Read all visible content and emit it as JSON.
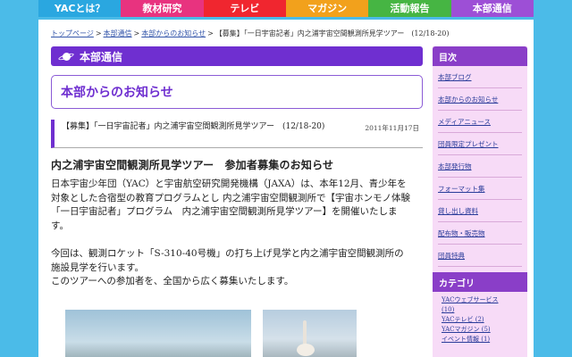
{
  "nav": {
    "items": [
      {
        "label": "YACとは？",
        "color": "#2aa7e0"
      },
      {
        "label": "教材研究",
        "color": "#e8337f"
      },
      {
        "label": "テレビ",
        "color": "#f0262f"
      },
      {
        "label": "マガジン",
        "color": "#f2a11c"
      },
      {
        "label": "活動報告",
        "color": "#46b543"
      },
      {
        "label": "本部通信",
        "color": "#9d4fd6"
      }
    ]
  },
  "breadcrumb": {
    "top": "トップページ",
    "honbu": "本部通信",
    "oshirase": "本部からのお知らせ",
    "current": "【募集】「一日宇宙記者」内之浦宇宙空間観測所見学ツアー　(12/18-20)",
    "separator": ">"
  },
  "section": {
    "bar_title": "本部通信",
    "notice_title": "本部からのお知らせ"
  },
  "article": {
    "title": "【募集】「一日宇宙記者」内之浦宇宙空間観測所見学ツアー　(12/18-20)",
    "date": "2011年11月17日",
    "headline": "内之浦宇宙空間観測所見学ツアー　参加者募集のお知らせ",
    "paragraph1": "日本宇宙少年団（YAC）と宇宙航空研究開発機構（JAXA）は、本年12月、青少年を対象とした合宿型の教育プログラムとし 内之浦宇宙空間観測所で【宇宙ホンモノ体験「一日宇宙記者」プログラム　内之浦宇宙空間観測所見学ツアー】を開催いたします。",
    "paragraph2": "今回は、観測ロケット「S-310-40号機」の打ち上げ見学と内之浦宇宙空間観測所の施設見学を行います。",
    "paragraph3": "このツアーへの参加者を、全国から広く募集いたします。"
  },
  "sidebar": {
    "menu_title": "目次",
    "items": [
      "本部ブログ",
      "本部からのお知らせ",
      "メディアニュース",
      "団員限定プレゼント",
      "本部発行物",
      "フォーマット集",
      "貸し出し資料",
      "配布物・販売物",
      "団員特典"
    ],
    "category_title": "カテゴリ",
    "categories": [
      "YACウェブサービス",
      "(10)",
      "YACテレビ (2)",
      "YACマガジン (5)",
      "イベント情報 (1)"
    ]
  },
  "colors": {
    "background": "#4bbbe8",
    "accent_purple": "#6f2fd0",
    "sidebar_bg": "#f7dbf7",
    "link": "#2a3c9a"
  }
}
